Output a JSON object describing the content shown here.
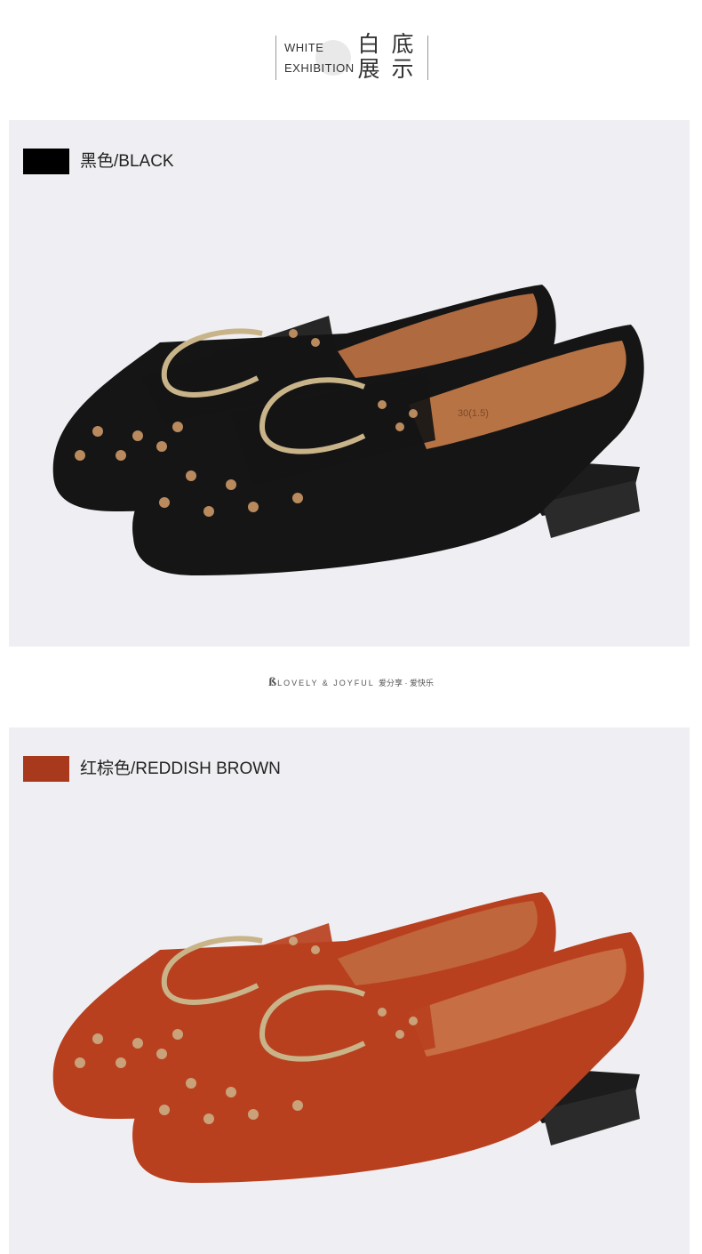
{
  "header": {
    "title_en_line1": "WHITE",
    "title_en_line2": "EXHIBITION",
    "title_cn_col1_top": "白",
    "title_cn_col1_bottom": "展",
    "title_cn_col2_top": "底",
    "title_cn_col2_bottom": "示"
  },
  "products": [
    {
      "label": "黑色/BLACK",
      "swatch_color": "#000000",
      "shoe_color": "#151515"
    },
    {
      "label": "红棕色/REDDISH BROWN",
      "swatch_color": "#a8391c",
      "shoe_color": "#b9401f"
    }
  ],
  "brand_strip": {
    "logo_glyph": "ß",
    "text_en": "LOVELY & JOYFUL",
    "text_cn": "爱分享 · 爱快乐"
  },
  "insole_stamp": "30(1.5)"
}
